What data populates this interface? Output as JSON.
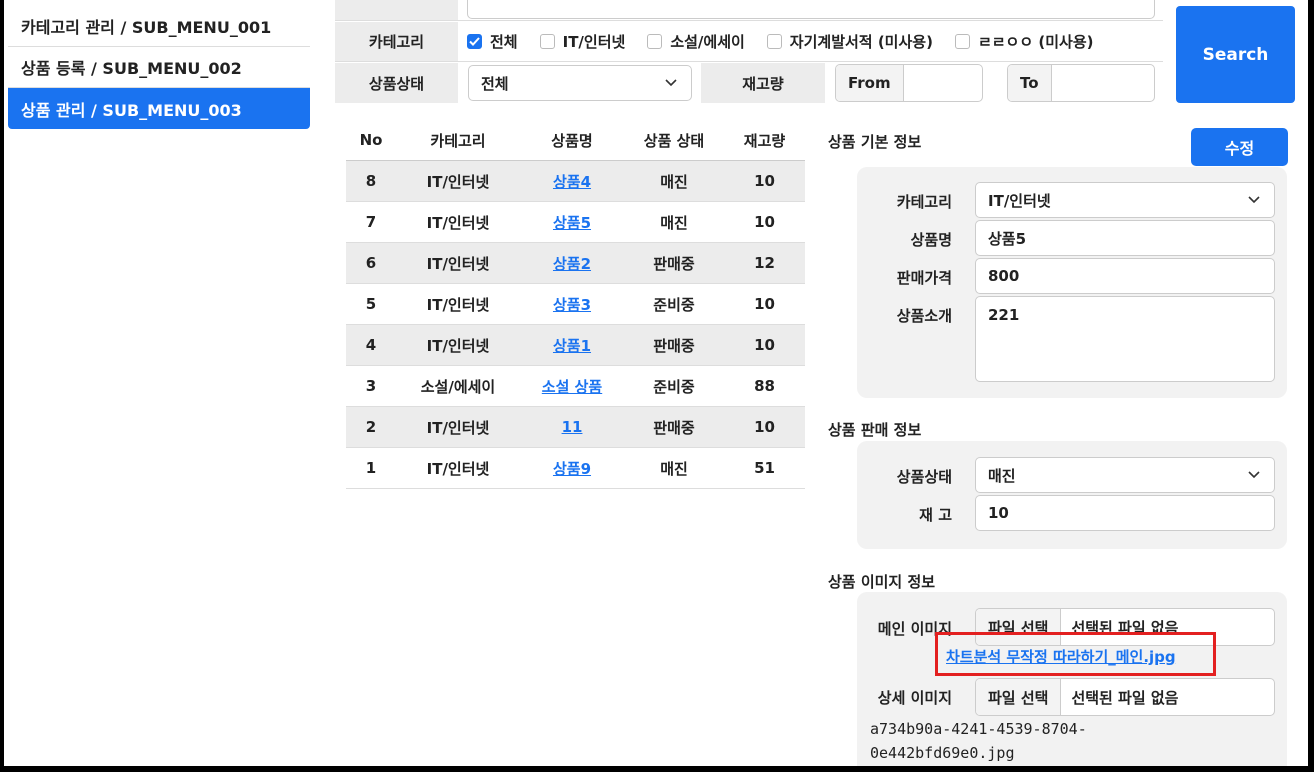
{
  "sidebar": {
    "items": [
      {
        "label": "카테고리 관리 / SUB_MENU_001",
        "active": false
      },
      {
        "label": "상품 등록 / SUB_MENU_002",
        "active": false
      },
      {
        "label": "상품 관리 / SUB_MENU_003",
        "active": true
      }
    ]
  },
  "search": {
    "category_label": "카테고리",
    "categories": [
      {
        "label": "전체",
        "checked": true
      },
      {
        "label": "IT/인터넷",
        "checked": false
      },
      {
        "label": "소설/에세이",
        "checked": false
      },
      {
        "label": "자기계발서적 (미사용)",
        "checked": false
      },
      {
        "label": "ㄹㄹㅇㅇ (미사용)",
        "checked": false
      }
    ],
    "status_label": "상품상태",
    "status_value": "전체",
    "stock_label": "재고량",
    "from_label": "From",
    "from_value": "",
    "to_label": "To",
    "to_value": "",
    "search_button": "Search"
  },
  "table": {
    "headers": {
      "no": "No",
      "category": "카테고리",
      "name": "상품명",
      "status": "상품 상태",
      "stock": "재고량"
    },
    "rows": [
      {
        "no": "8",
        "category": "IT/인터넷",
        "name": "상품4",
        "status": "매진",
        "stock": "10"
      },
      {
        "no": "7",
        "category": "IT/인터넷",
        "name": "상품5",
        "status": "매진",
        "stock": "10"
      },
      {
        "no": "6",
        "category": "IT/인터넷",
        "name": "상품2",
        "status": "판매중",
        "stock": "12"
      },
      {
        "no": "5",
        "category": "IT/인터넷",
        "name": "상품3",
        "status": "준비중",
        "stock": "10"
      },
      {
        "no": "4",
        "category": "IT/인터넷",
        "name": "상품1",
        "status": "판매중",
        "stock": "10"
      },
      {
        "no": "3",
        "category": "소설/에세이",
        "name": "소설 상품",
        "status": "준비중",
        "stock": "88"
      },
      {
        "no": "2",
        "category": "IT/인터넷",
        "name": "11",
        "status": "판매중",
        "stock": "10"
      },
      {
        "no": "1",
        "category": "IT/인터넷",
        "name": "상품9",
        "status": "매진",
        "stock": "51"
      }
    ]
  },
  "detail": {
    "basic_title": "상품 기본 정보",
    "edit_button": "수정",
    "category_label": "카테고리",
    "category_value": "IT/인터넷",
    "name_label": "상품명",
    "name_value": "상품5",
    "price_label": "판매가격",
    "price_value": "800",
    "desc_label": "상품소개",
    "desc_value": "221",
    "sales_title": "상품 판매 정보",
    "status_label": "상품상태",
    "status_value": "매진",
    "stock_label": "재 고",
    "stock_value": "10",
    "image_title": "상품 이미지 정보",
    "main_image_label": "메인 이미지",
    "file_select": "파일 선택",
    "no_file": "선택된 파일 없음",
    "main_image_link": "차트분석 무작정 따라하기_메인.jpg",
    "detail_image_label": "상세 이미지",
    "detail_file_line1": "a734b90a-4241-4539-8704-",
    "detail_file_line2": "0e442bfd69e0.jpg"
  },
  "colors": {
    "accent": "#1a73f0",
    "highlight": "#e32020",
    "shade": "#ececec"
  }
}
